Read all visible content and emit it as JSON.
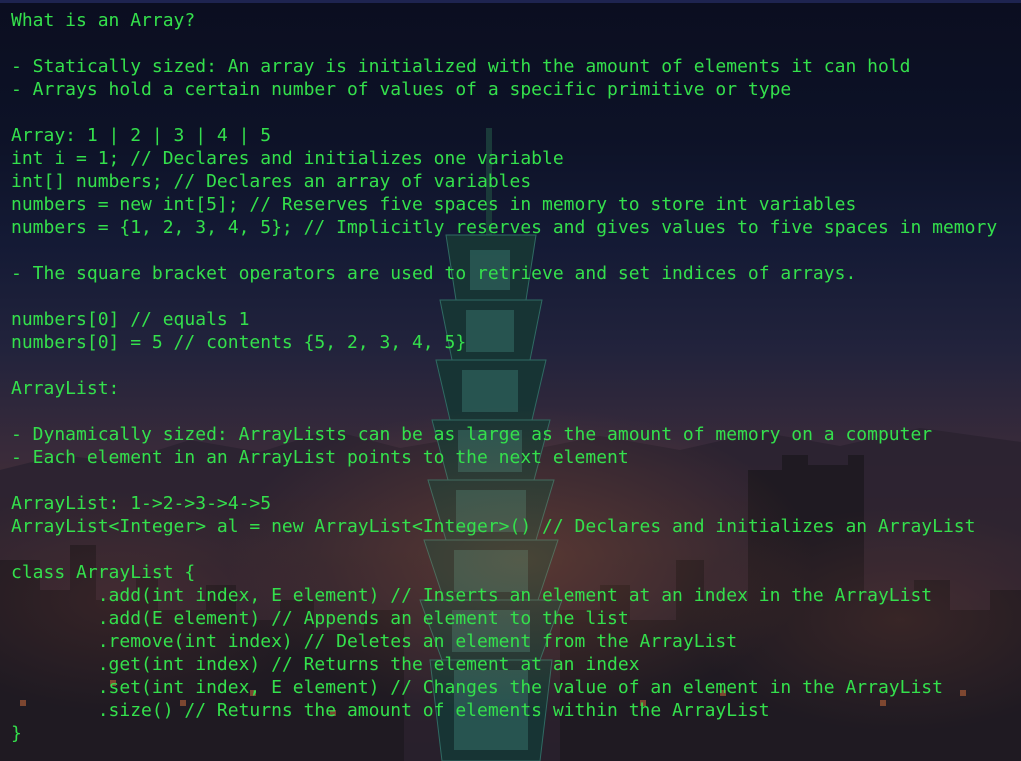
{
  "theme": {
    "text_color": "#34e04c",
    "background": "#0b0e20"
  },
  "lines": [
    "What is an Array?",
    "",
    "- Statically sized: An array is initialized with the amount of elements it can hold",
    "- Arrays hold a certain number of values of a specific primitive or type",
    "",
    "Array: 1 | 2 | 3 | 4 | 5",
    "int i = 1; // Declares and initializes one variable",
    "int[] numbers; // Declares an array of variables",
    "numbers = new int[5]; // Reserves five spaces in memory to store int variables",
    "numbers = {1, 2, 3, 4, 5}; // Implicitly reserves and gives values to five spaces in memory",
    "",
    "- The square bracket operators are used to retrieve and set indices of arrays.",
    "",
    "numbers[0] // equals 1",
    "numbers[0] = 5 // contents {5, 2, 3, 4, 5}",
    "",
    "ArrayList:",
    "",
    "- Dynamically sized: ArrayLists can be as large as the amount of memory on a computer",
    "- Each element in an ArrayList points to the next element",
    "",
    "ArrayList: 1->2->3->4->5",
    "ArrayList<Integer> al = new ArrayList<Integer>() // Declares and initializes an ArrayList",
    "",
    "class ArrayList {",
    "        .add(int index, E element) // Inserts an element at an index in the ArrayList",
    "        .add(E element) // Appends an element to the list",
    "        .remove(int index) // Deletes an element from the ArrayList",
    "        .get(int index) // Returns the element at an index",
    "        .set(int index, E element) // Changes the value of an element in the ArrayList",
    "        .size() // Returns the amount of elements within the ArrayList",
    "}"
  ]
}
